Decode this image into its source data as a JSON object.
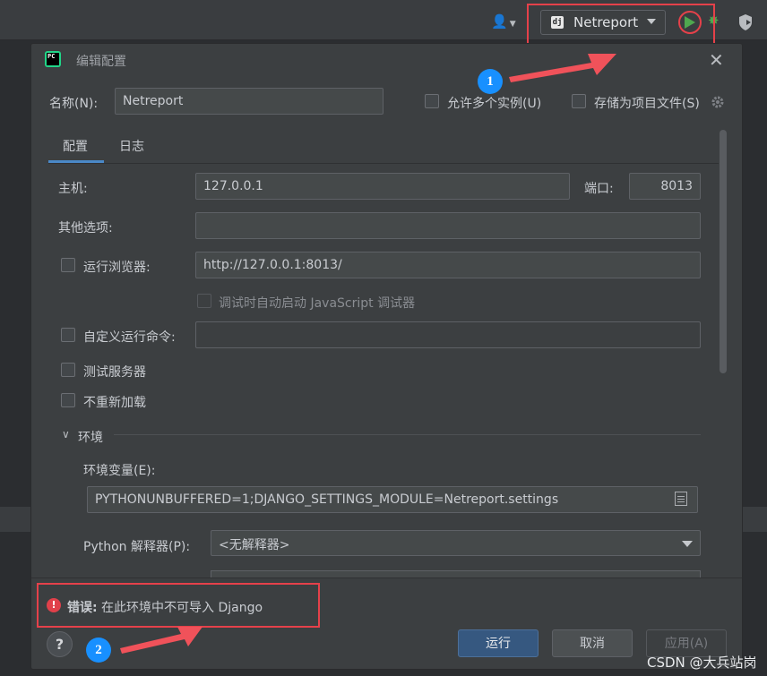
{
  "toolbar": {
    "run_config_label": "Netreport",
    "user_icon": "user-icon",
    "run_icon": "run-icon",
    "debug_icon": "debug-icon",
    "coverage_icon": "coverage-icon"
  },
  "dialog": {
    "title": "编辑配置",
    "app_icon_text": "PC",
    "name_label": "名称(N):",
    "name_value": "Netreport",
    "allow_multiple_label": "允许多个实例(U)",
    "store_project_label": "存储为项目文件(S)",
    "tabs": [
      {
        "label": "配置",
        "active": true
      },
      {
        "label": "日志",
        "active": false
      }
    ],
    "host_label": "主机:",
    "host_value": "127.0.0.1",
    "port_label": "端口:",
    "port_value": "8013",
    "other_options_label": "其他选项:",
    "other_options_value": "",
    "run_browser_label": "运行浏览器:",
    "run_browser_value": "http://127.0.0.1:8013/",
    "js_debugger_label": "调试时自动启动 JavaScript 调试器",
    "custom_cmd_label": "自定义运行命令:",
    "custom_cmd_value": "",
    "test_server_label": "测试服务器",
    "no_reload_label": "不重新加载",
    "env_section_label": "环境",
    "env_vars_label": "环境变量(E):",
    "env_vars_value": "PYTHONUNBUFFERED=1;DJANGO_SETTINGS_MODULE=Netreport.settings",
    "interpreter_label": "Python 解释器(P):",
    "interpreter_value": "<无解释器>",
    "error_prefix": "错误:",
    "error_message": "在此环境中不可导入 Django",
    "help_label": "?",
    "run_button": "运行",
    "cancel_button": "取消",
    "apply_button": "应用(A)"
  },
  "annotations": {
    "badge_1": "1",
    "badge_2": "2",
    "accent_color": "#e5414a",
    "badge_color": "#1890ff"
  },
  "watermark": "CSDN @大兵站岗"
}
